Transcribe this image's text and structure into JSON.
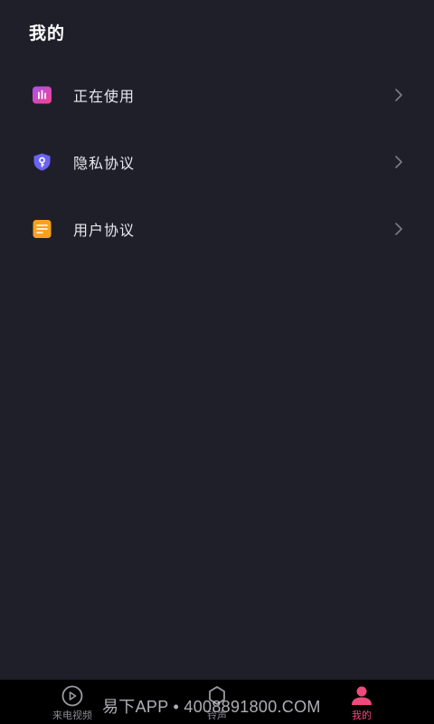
{
  "header": {
    "title": "我的"
  },
  "menu": {
    "items": [
      {
        "label": "正在使用",
        "icon": "equalizer-icon",
        "icon_color": "#e84aa8"
      },
      {
        "label": "隐私协议",
        "icon": "shield-key-icon",
        "icon_color": "#6b63f5"
      },
      {
        "label": "用户协议",
        "icon": "document-icon",
        "icon_color": "#f8a21c"
      }
    ],
    "chevron_icon": "chevron-right-icon"
  },
  "tabbar": {
    "tabs": [
      {
        "label": "来电视频",
        "icon": "play-circle-icon",
        "active": false
      },
      {
        "label": "铃声",
        "icon": "bell-icon",
        "active": false
      },
      {
        "label": "我的",
        "icon": "person-icon",
        "active": true
      }
    ],
    "active_color": "#ef4a7b",
    "inactive_color": "#8a8a93"
  },
  "watermark": {
    "text": "易下APP • 4008891800.COM"
  }
}
